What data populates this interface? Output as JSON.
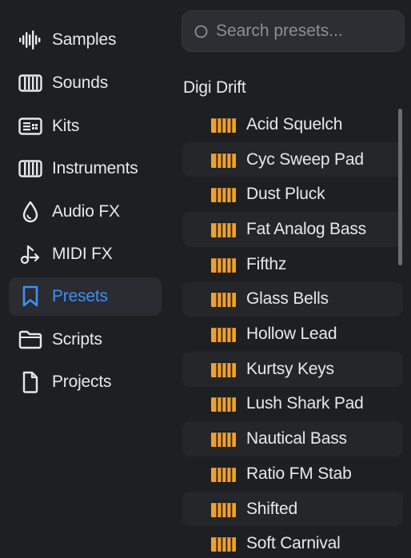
{
  "sidebar": {
    "items": [
      {
        "label": "Samples",
        "icon": "waveform-icon",
        "active": false
      },
      {
        "label": "Sounds",
        "icon": "keyboard-icon",
        "active": false
      },
      {
        "label": "Kits",
        "icon": "drum-pad-icon",
        "active": false
      },
      {
        "label": "Instruments",
        "icon": "keyboard-icon",
        "active": false
      },
      {
        "label": "Audio FX",
        "icon": "drop-icon",
        "active": false
      },
      {
        "label": "MIDI FX",
        "icon": "midi-note-icon",
        "active": false
      },
      {
        "label": "Presets",
        "icon": "bookmark-icon",
        "active": true
      },
      {
        "label": "Scripts",
        "icon": "folder-icon",
        "active": false
      },
      {
        "label": "Projects",
        "icon": "document-icon",
        "active": false
      }
    ]
  },
  "search": {
    "placeholder": "Search presets...",
    "value": ""
  },
  "group": {
    "title": "Digi Drift"
  },
  "presets": [
    "Acid Squelch",
    "Cyc Sweep Pad",
    "Dust Pluck",
    "Fat Analog Bass",
    "Fifthz",
    "Glass Bells",
    "Hollow Lead",
    "Kurtsy Keys",
    "Lush Shark Pad",
    "Nautical Bass",
    "Ratio FM Stab",
    "Shifted",
    "Soft Carnival"
  ],
  "colors": {
    "accent": "#3f8ff6",
    "preset_icon": "#f0a02a",
    "background": "#1e1f22"
  }
}
